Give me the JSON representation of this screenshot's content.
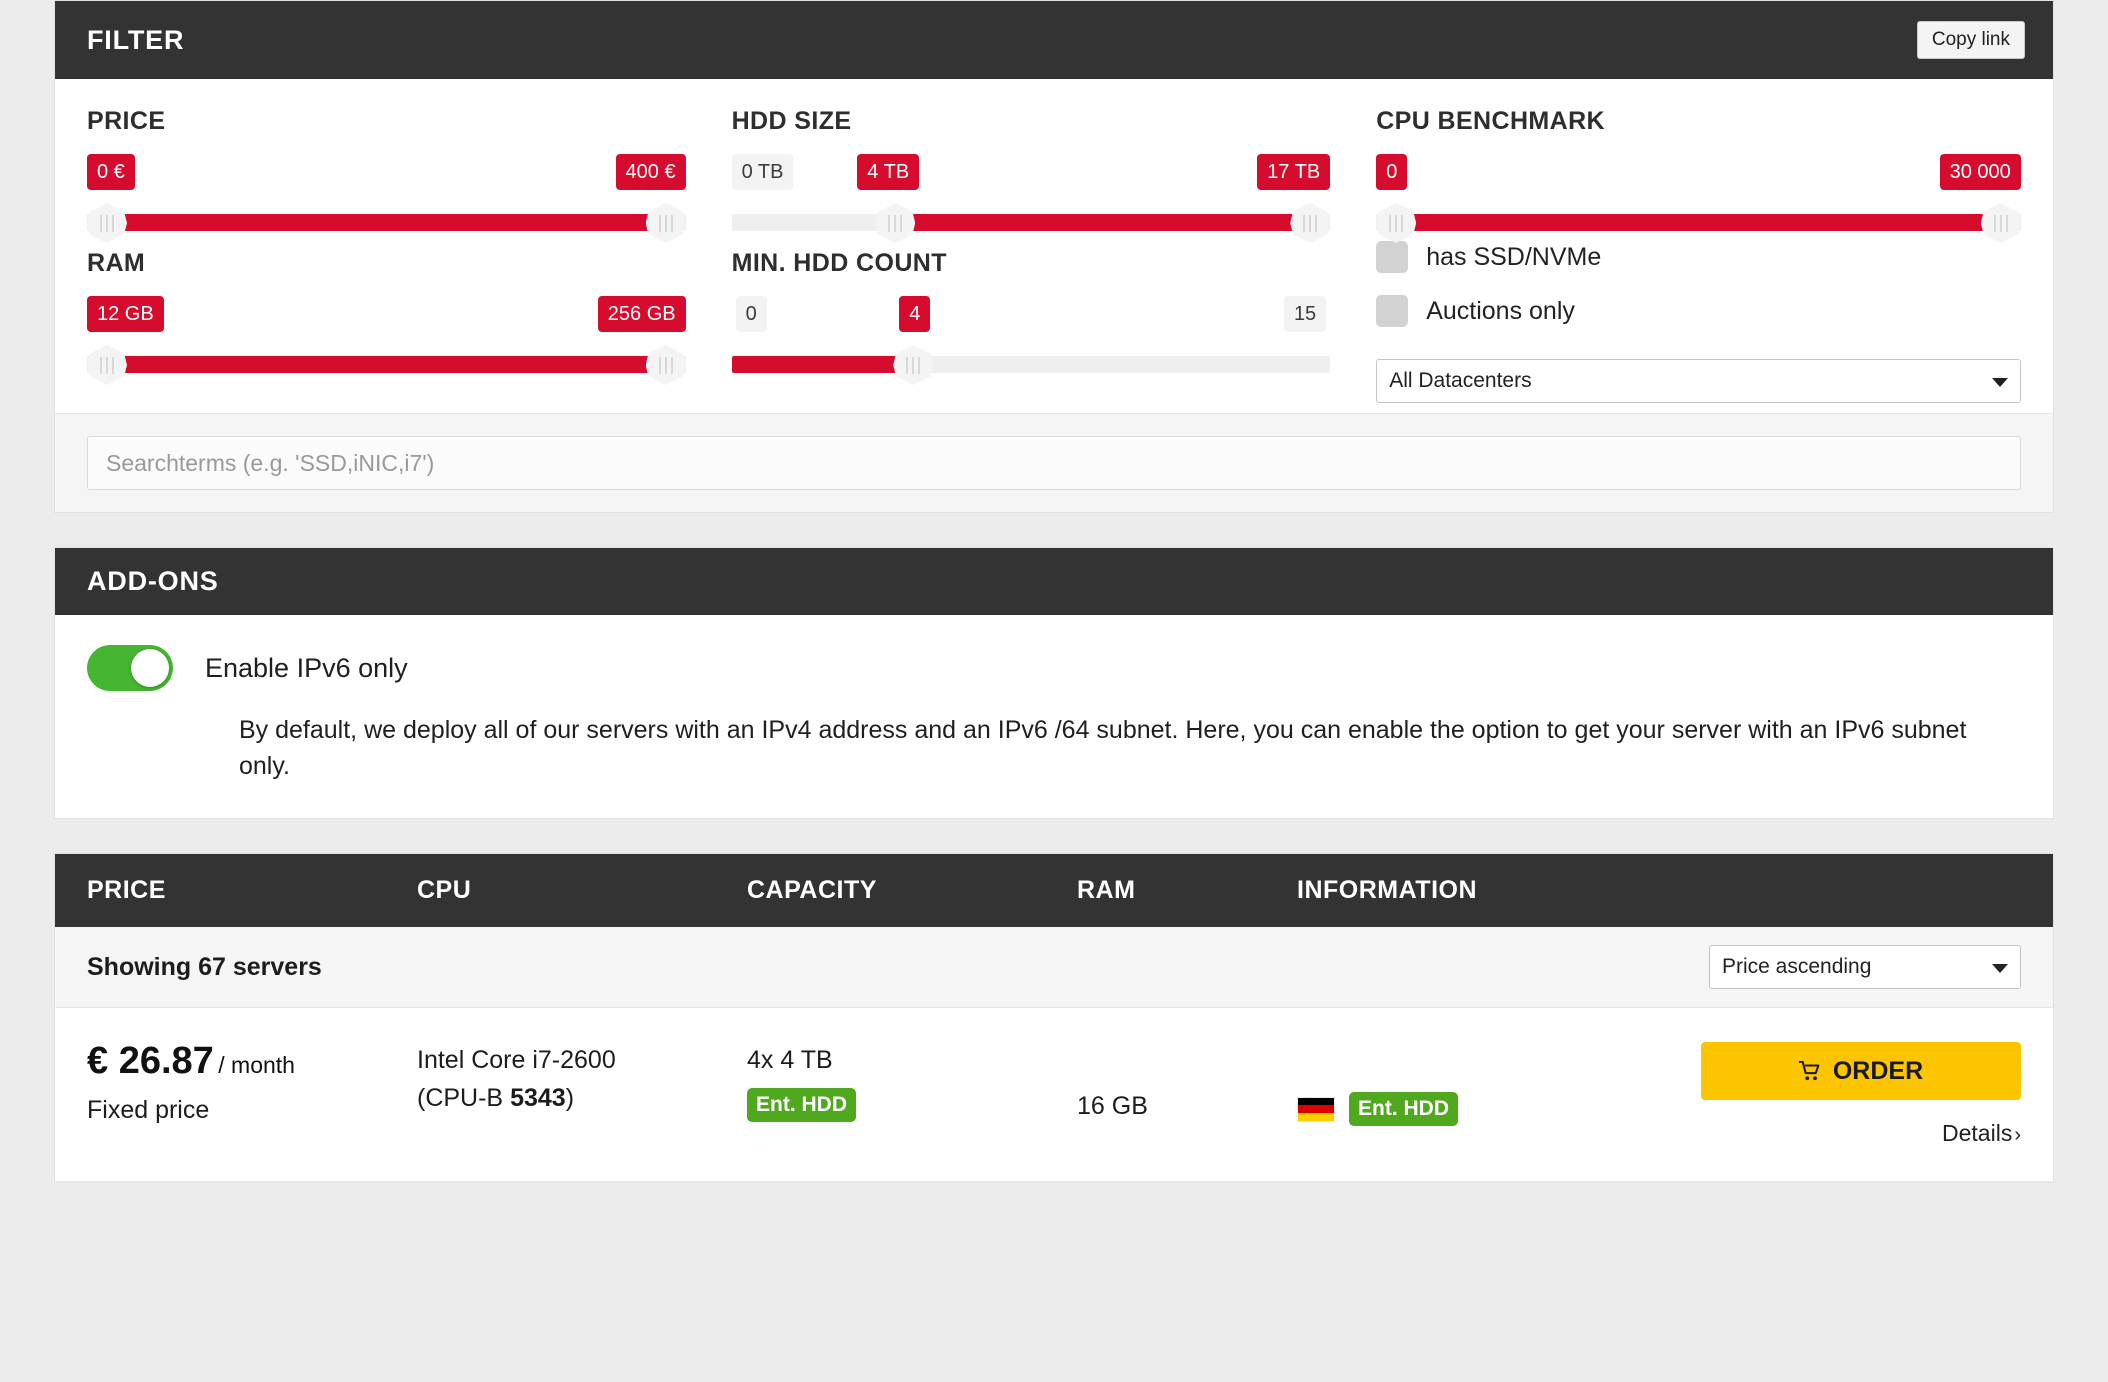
{
  "filter": {
    "title": "FILTER",
    "copy_link_label": "Copy link",
    "accent_color": "#d50c2d",
    "price": {
      "title": "PRICE",
      "min_label": "0 €",
      "max_label": "400 €",
      "min_active": true,
      "max_active": true,
      "fill_start_pct": 0,
      "fill_end_pct": 100
    },
    "hdd_size": {
      "title": "HDD SIZE",
      "min_label": "0 TB",
      "value_label": "4 TB",
      "max_label": "17 TB",
      "min_active": false,
      "fill_start_pct": 24,
      "fill_end_pct": 100
    },
    "cpu_benchmark": {
      "title": "CPU BENCHMARK",
      "min_label": "0",
      "max_label": "30 000",
      "fill_start_pct": 0,
      "fill_end_pct": 100
    },
    "ram": {
      "title": "RAM",
      "min_label": "12 GB",
      "max_label": "256 GB",
      "fill_start_pct": 0,
      "fill_end_pct": 100
    },
    "hdd_count": {
      "title": "MIN. HDD COUNT",
      "min_label": "0",
      "value_label": "4",
      "max_label": "15",
      "fill_start_pct": 0,
      "fill_end_pct": 29
    },
    "checkboxes": [
      {
        "label": "has SSD/NVMe",
        "checked": false
      },
      {
        "label": "Auctions only",
        "checked": false
      }
    ],
    "datacenter_select": {
      "selected": "All Datacenters",
      "options": [
        "All Datacenters"
      ]
    },
    "search": {
      "placeholder": "Searchterms (e.g. 'SSD,iNIC,i7')",
      "value": ""
    }
  },
  "addons": {
    "title": "ADD-ONS",
    "toggle": {
      "label": "Enable IPv6 only",
      "enabled": true,
      "on_color": "#46b531"
    },
    "description": "By default, we deploy all of our servers with an IPv4 address and an IPv6 /64 subnet. Here, you can enable the option to get your server with an IPv6 subnet only."
  },
  "results": {
    "columns": {
      "price": "PRICE",
      "cpu": "CPU",
      "capacity": "CAPACITY",
      "ram": "RAM",
      "information": "INFORMATION"
    },
    "showing": "Showing 67 servers",
    "sort_select": {
      "selected": "Price ascending",
      "options": [
        "Price ascending"
      ]
    },
    "rows": [
      {
        "price_amount": "€ 26.87",
        "price_period": "/ month",
        "price_note": "Fixed price",
        "cpu_name": "Intel Core i7-2600",
        "cpu_bench_prefix": "(CPU-B ",
        "cpu_bench_value": "5343",
        "cpu_bench_suffix": ")",
        "capacity": "4x 4 TB",
        "capacity_badge": "Ent. HDD",
        "ram": "16 GB",
        "flag_country": "Germany",
        "info_badge": "Ent. HDD",
        "order_label": "ORDER",
        "details_label": "Details"
      }
    ]
  },
  "icons": {
    "cart": "cart-icon",
    "chevron_right": "›"
  }
}
